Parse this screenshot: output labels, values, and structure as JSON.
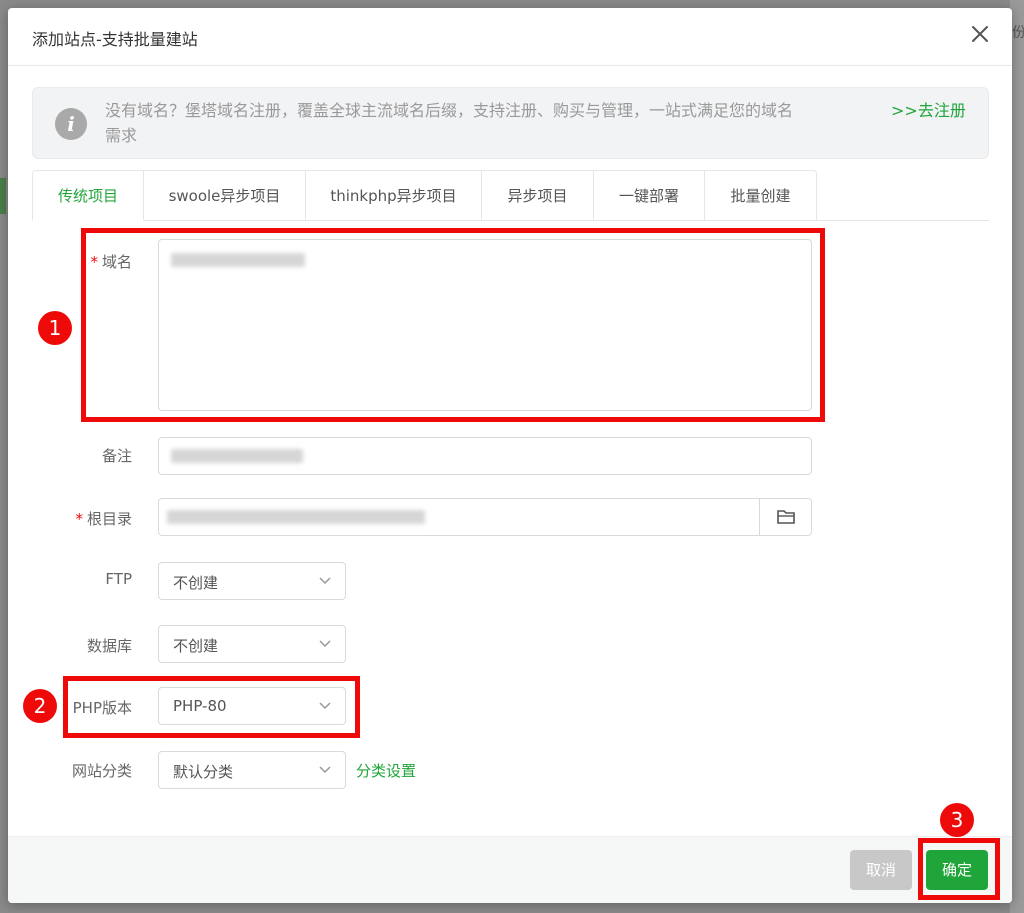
{
  "backdrop": {
    "edge_glyph": "份"
  },
  "dialog": {
    "title": "添加站点-支持批量建站",
    "close_icon": "close-icon"
  },
  "notice": {
    "icon": "info-icon",
    "icon_glyph": "i",
    "text": "没有域名？堡塔域名注册，覆盖全球主流域名后缀，支持注册、购买与管理，一站式满足您的域名需求",
    "link": ">>去注册"
  },
  "tabs": [
    {
      "label": "传统项目",
      "active": true
    },
    {
      "label": "swoole异步项目"
    },
    {
      "label": "thinkphp异步项目"
    },
    {
      "label": "异步项目"
    },
    {
      "label": "一键部署"
    },
    {
      "label": "批量创建"
    }
  ],
  "form": {
    "required_mark": "*",
    "domain": {
      "label": "域名"
    },
    "remark": {
      "label": "备注"
    },
    "root": {
      "label": "根目录",
      "folder_icon": "folder-icon"
    },
    "ftp": {
      "label": "FTP",
      "value": "不创建"
    },
    "database": {
      "label": "数据库",
      "value": "不创建"
    },
    "php": {
      "label": "PHP版本",
      "value": "PHP-80"
    },
    "category": {
      "label": "网站分类",
      "value": "默认分类",
      "link": "分类设置"
    }
  },
  "footer": {
    "cancel": "取消",
    "confirm": "确定"
  },
  "annotations": [
    "1",
    "2",
    "3"
  ],
  "colors": {
    "accent": "#20a53a",
    "annotation": "#ef0a0a",
    "disabled": "#c8c8c8"
  }
}
